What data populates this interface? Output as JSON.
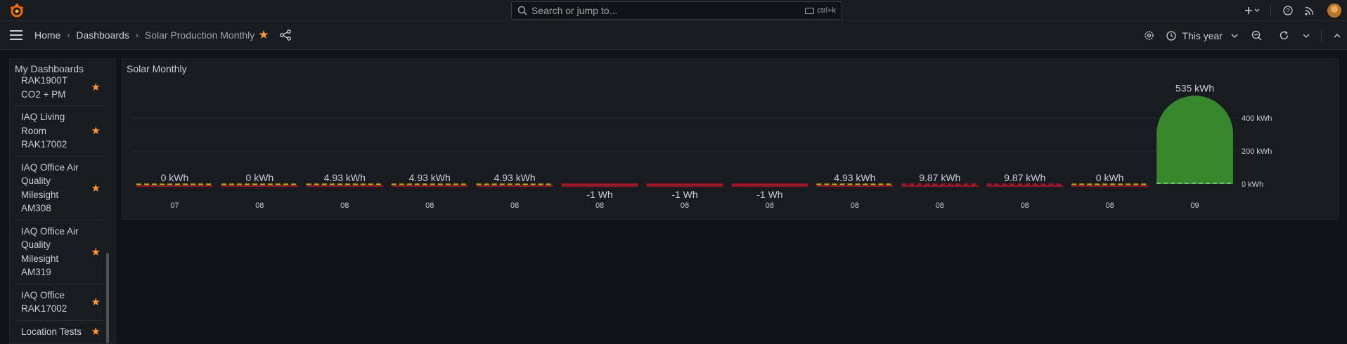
{
  "topbar": {
    "search_placeholder": "Search or jump to...",
    "search_shortcut": "ctrl+k",
    "add_icon": "plus-icon",
    "help_icon": "help-icon",
    "news_icon": "rss-icon"
  },
  "navbar": {
    "breadcrumbs": [
      "Home",
      "Dashboards",
      "Solar Production Monthly"
    ],
    "time_range": "This year",
    "colors": {
      "star": "#ff9830"
    }
  },
  "sidebar": {
    "title": "My Dashboards",
    "items": [
      {
        "label": "RAK1900T CO2 + PM"
      },
      {
        "label": "IAQ Living Room RAK17002"
      },
      {
        "label": "IAQ Office Air Quality Milesight AM308"
      },
      {
        "label": "IAQ Office Air Quality Milesight AM319"
      },
      {
        "label": "IAQ Office RAK17002"
      },
      {
        "label": "Location Tests"
      }
    ]
  },
  "panel": {
    "title": "Solar Monthly"
  },
  "chart_data": {
    "type": "bar",
    "categories": [
      "07",
      "08",
      "08",
      "08",
      "08",
      "08",
      "08",
      "08",
      "08",
      "08",
      "08",
      "08",
      "09"
    ],
    "value_labels": [
      "0 kWh",
      "0 kWh",
      "4.93 kWh",
      "4.93 kWh",
      "4.93 kWh",
      "-1 Wh",
      "-1 Wh",
      "-1 Wh",
      "4.93 kWh",
      "9.87 kWh",
      "9.87 kWh",
      "0 kWh",
      "535 kWh"
    ],
    "values_kwh": [
      0,
      0,
      4.93,
      4.93,
      4.93,
      -0.001,
      -0.001,
      -0.001,
      4.93,
      9.87,
      9.87,
      0,
      535
    ],
    "y_ticks": [
      "0 kWh",
      "200 kWh",
      "400 kWh"
    ],
    "y_tick_values": [
      0,
      200,
      400
    ],
    "ylim": [
      0,
      535
    ],
    "grid": true,
    "colors": {
      "positive": "#37872d",
      "small": "#e0b400",
      "negative": "#c4162a"
    }
  }
}
